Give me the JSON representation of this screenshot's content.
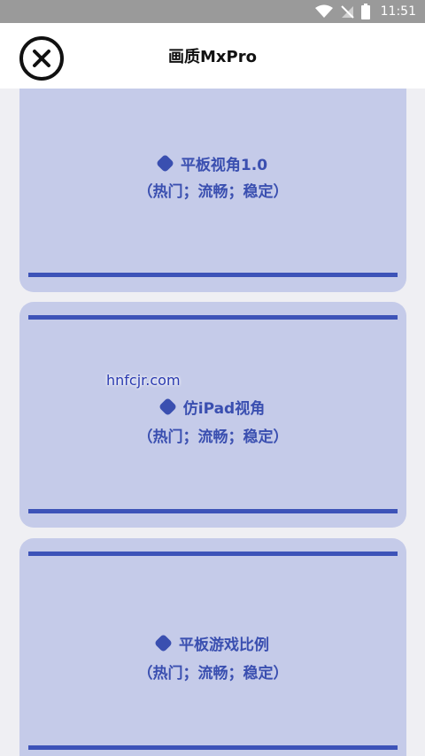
{
  "status": {
    "time": "11:51"
  },
  "header": {
    "title": "画质MxPro"
  },
  "options": [
    {
      "label": "平板视角1.0",
      "subtitle": "（热门；流畅；稳定）"
    },
    {
      "label": "仿iPad视角",
      "subtitle": "（热门；流畅；稳定）"
    },
    {
      "label": "平板游戏比例",
      "subtitle": "（热门；流畅；稳定）"
    }
  ],
  "watermark": "hnfcjr.com",
  "colors": {
    "card": "#c5cbe9",
    "accent": "#3d53b8",
    "text": "#3a4fb0"
  }
}
